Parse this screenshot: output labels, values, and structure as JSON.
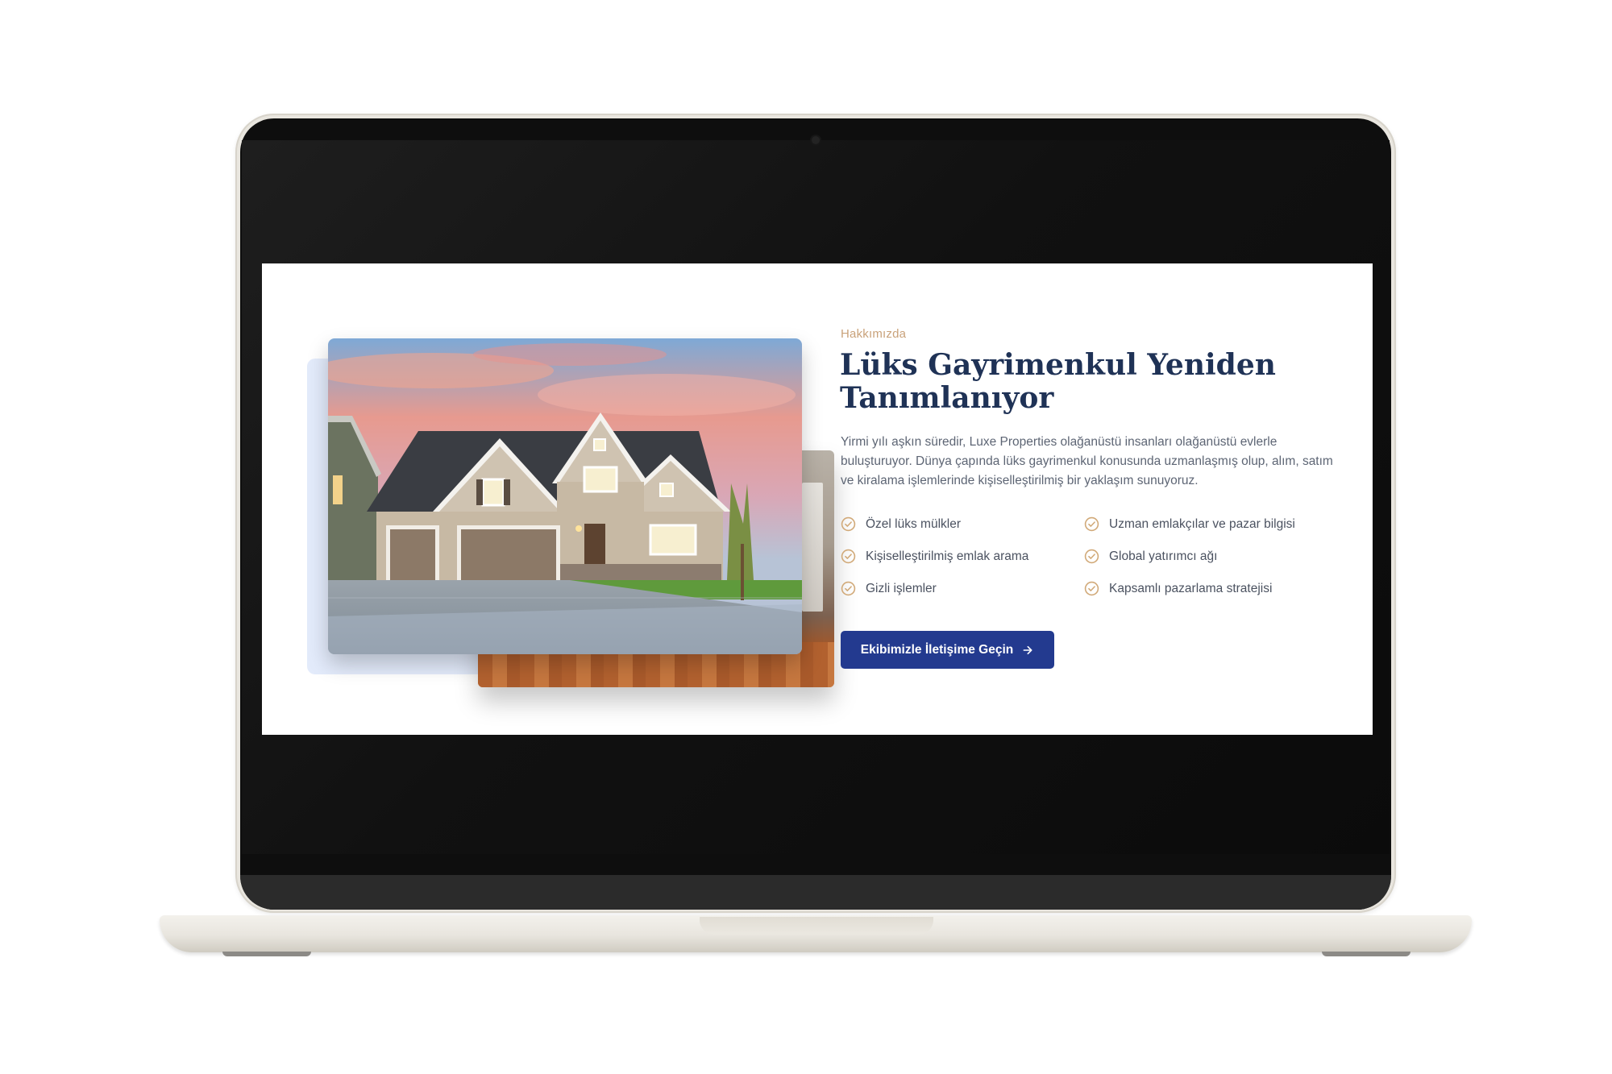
{
  "about": {
    "eyebrow": "Hakkımızda",
    "title_line1": "Lüks Gayrimenkul Yeniden",
    "title_line2": "Tanımlanıyor",
    "description": "Yirmi yılı aşkın süredir, Luxe Properties olağanüstü insanları olağanüstü evlerle buluşturuyor. Dünya çapında lüks gayrimenkul konusunda uzmanlaşmış olup, alım, satım ve kiralama işlemlerinde kişiselleştirilmiş bir yaklaşım sunuyoruz.",
    "features": [
      "Özel lüks mülkler",
      "Uzman emlakçılar ve pazar bilgisi",
      "Kişiselleştirilmiş emlak arama",
      "Global yatırımcı ağı",
      "Gizli işlemler",
      "Kapsamlı pazarlama stratejisi"
    ],
    "cta_label": "Ekibimizle İletişime Geçin"
  },
  "icons": {
    "feature_icon": "check-circle-icon",
    "cta_icon": "arrow-right-icon"
  },
  "colors": {
    "accent": "#233a8f",
    "heading": "#1f3256",
    "eyebrow": "#c9a27a",
    "check": "#d1a978",
    "body_text": "#5d6574"
  }
}
